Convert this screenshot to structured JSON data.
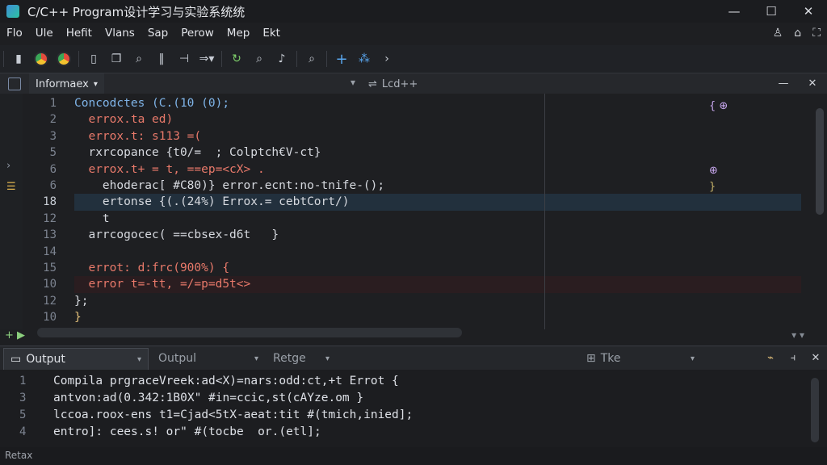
{
  "window": {
    "title": "C/C++ Program设计学习与实验系统统"
  },
  "menu": [
    "Flo",
    "Ule",
    "Hefit",
    "Vlans",
    "Sap",
    "Perow",
    "Mep",
    "Ekt"
  ],
  "editor": {
    "tab_left": "Informaex",
    "tab_right": "Lcd++",
    "lines": [
      {
        "num": "1",
        "text": "Concodctes (C.(10 (0);"
      },
      {
        "num": "2",
        "text": "  errox.ta ed)"
      },
      {
        "num": "3",
        "text": "  errox.t: s113 =("
      },
      {
        "num": "5",
        "text": "  rxrcopance {t0/=  ; Colptch€V-ct}"
      },
      {
        "num": "6",
        "text": "  errox.t+ = t, ==ep=<cX> ."
      },
      {
        "num": "6",
        "text": "    ehoderac[ #C80)} error.ecnt:no-tnife-();"
      },
      {
        "num": "18",
        "text": "    ertonse {(.(24%) Errox.= cebtCort/)"
      },
      {
        "num": "12",
        "text": "    t"
      },
      {
        "num": "13",
        "text": "  arrcogocec( ==cbsex-d6t   }"
      },
      {
        "num": "14",
        "text": ""
      },
      {
        "num": "15",
        "text": "  errot: d:frc(900%) {"
      },
      {
        "num": "10",
        "text": "  error t=-tt, =/=p=d5t<>"
      },
      {
        "num": "12",
        "text": "};"
      },
      {
        "num": "10",
        "text": "}"
      }
    ],
    "minimap_marks": [
      "{ ⊕",
      "",
      "",
      "",
      "⊕",
      "}"
    ]
  },
  "panel": {
    "tabs": [
      {
        "label": "Output",
        "active": true
      },
      {
        "label": "Outpul",
        "active": false
      },
      {
        "label": "Retge",
        "active": false
      },
      {
        "label": "Tke",
        "active": false
      }
    ],
    "lines": [
      {
        "num": "1",
        "text": "Compila prgraceVreek:ad<X)=nars:odd:ct,+t Errot {"
      },
      {
        "num": "3",
        "text": "antvon:ad(0.342:1B0X\" #in=ccic,st(cAYze.om }"
      },
      {
        "num": "5",
        "text": "lccoa.roox-ens t1=Cjad<5tX-aeat:tit #(tmich,inied];"
      },
      {
        "num": "4",
        "text": "entro]: cees.s! or\" #(tocbe  or.(etl];"
      }
    ]
  },
  "status": {
    "left": "Retax"
  },
  "colors": {
    "background": "#1e1f22",
    "keyword": "#e8796a",
    "accent": "#3c8fd6"
  }
}
